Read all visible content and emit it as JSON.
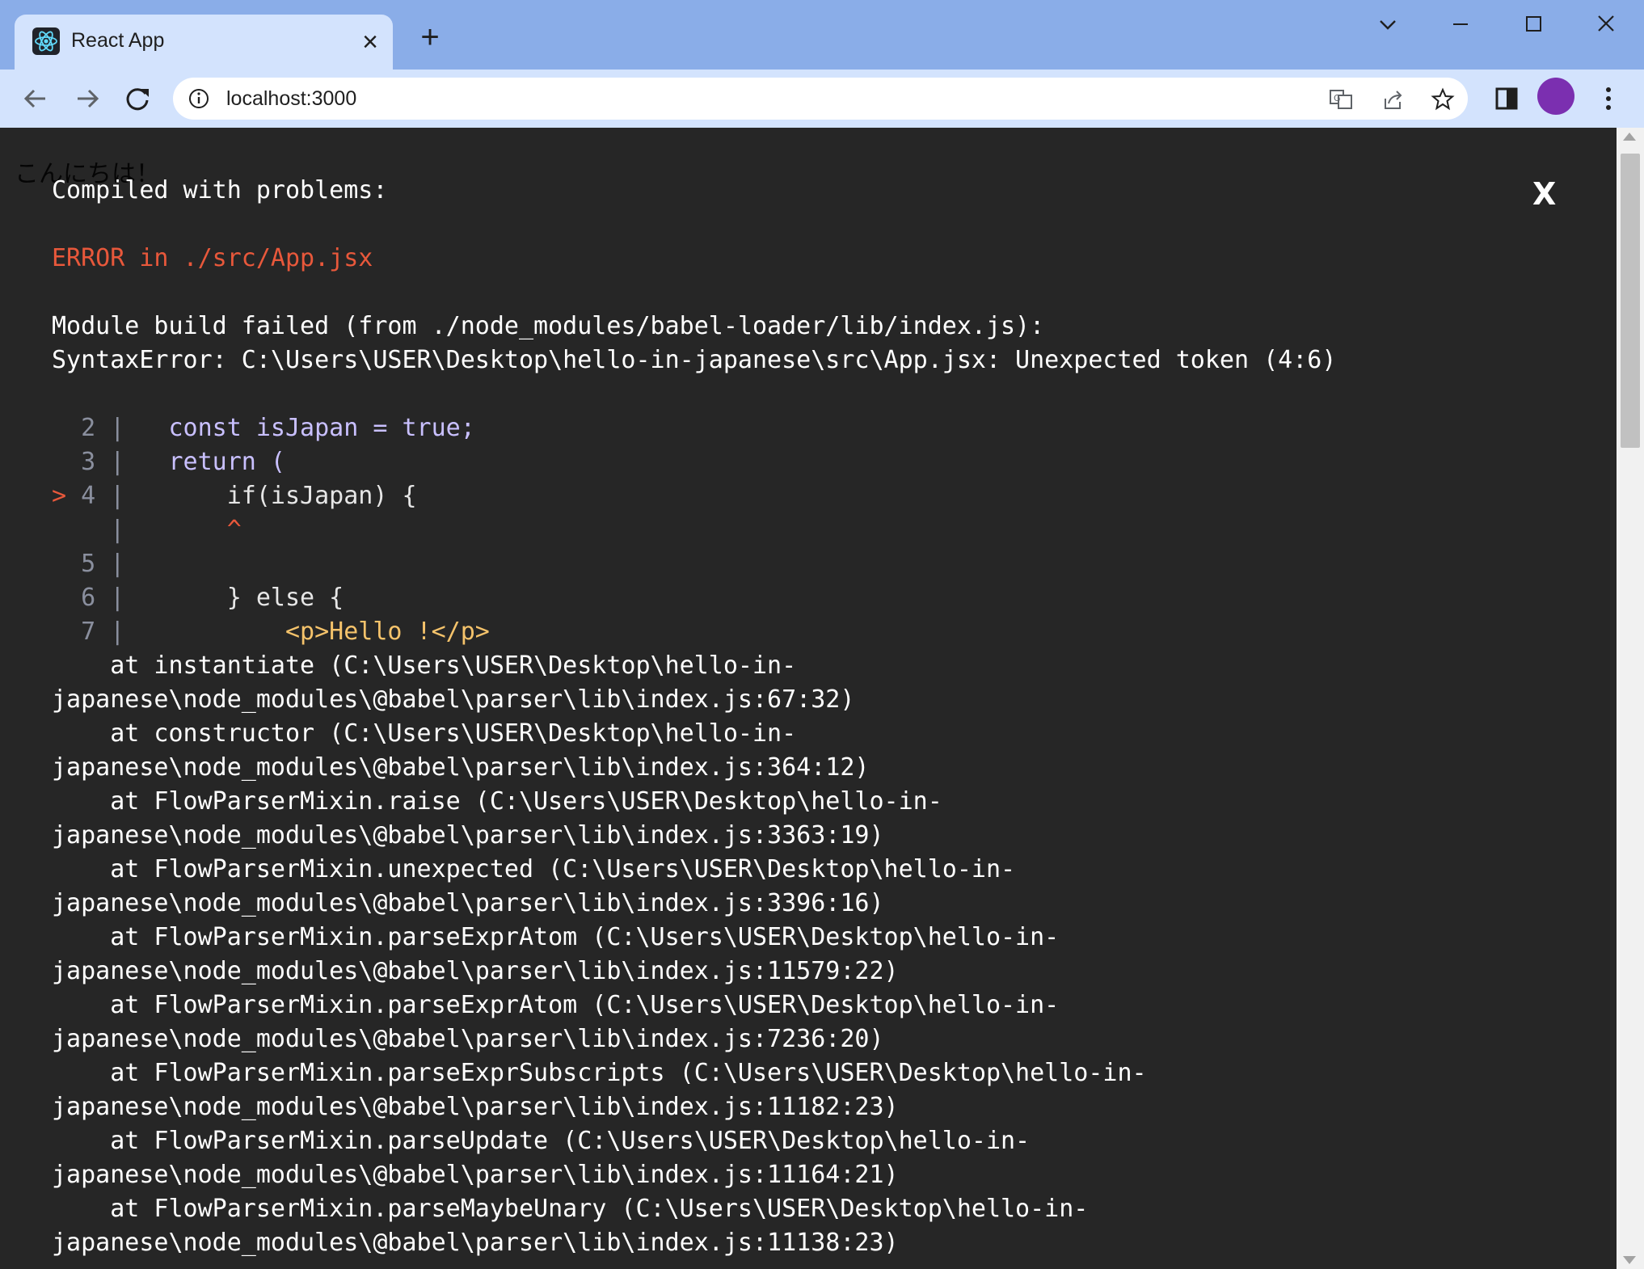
{
  "browser": {
    "tab_title": "React App",
    "tab_close": "×",
    "new_tab": "+",
    "url": "localhost:3000"
  },
  "page": {
    "background_text": "こんにちは！",
    "overlay": {
      "heading": "Compiled with problems:",
      "close": "X",
      "error_title": "ERROR in ./src/App.jsx",
      "message_lines": [
        "Module build failed (from ./node_modules/babel-loader/lib/index.js):",
        "SyntaxError: C:\\Users\\USER\\Desktop\\hello-in-japanese\\src\\App.jsx: Unexpected token (4:6)"
      ],
      "code_frame": [
        {
          "marker": " ",
          "num": "2",
          "code": "  const isJapan = true;"
        },
        {
          "marker": " ",
          "num": "3",
          "code": "  return ("
        },
        {
          "marker": ">",
          "num": "4",
          "code": "      if(isJapan) {"
        },
        {
          "marker": " ",
          "num": " ",
          "code": "      ^"
        },
        {
          "marker": " ",
          "num": "5",
          "code": ""
        },
        {
          "marker": " ",
          "num": "6",
          "code": "      } else {"
        },
        {
          "marker": " ",
          "num": "7",
          "code": "          <p>Hello !</p>"
        }
      ],
      "stack_lines": [
        "    at instantiate (C:\\Users\\USER\\Desktop\\hello-in-",
        "japanese\\node_modules\\@babel\\parser\\lib\\index.js:67:32)",
        "    at constructor (C:\\Users\\USER\\Desktop\\hello-in-",
        "japanese\\node_modules\\@babel\\parser\\lib\\index.js:364:12)",
        "    at FlowParserMixin.raise (C:\\Users\\USER\\Desktop\\hello-in-",
        "japanese\\node_modules\\@babel\\parser\\lib\\index.js:3363:19)",
        "    at FlowParserMixin.unexpected (C:\\Users\\USER\\Desktop\\hello-in-",
        "japanese\\node_modules\\@babel\\parser\\lib\\index.js:3396:16)",
        "    at FlowParserMixin.parseExprAtom (C:\\Users\\USER\\Desktop\\hello-in-",
        "japanese\\node_modules\\@babel\\parser\\lib\\index.js:11579:22)",
        "    at FlowParserMixin.parseExprAtom (C:\\Users\\USER\\Desktop\\hello-in-",
        "japanese\\node_modules\\@babel\\parser\\lib\\index.js:7236:20)",
        "    at FlowParserMixin.parseExprSubscripts (C:\\Users\\USER\\Desktop\\hello-in-",
        "japanese\\node_modules\\@babel\\parser\\lib\\index.js:11182:23)",
        "    at FlowParserMixin.parseUpdate (C:\\Users\\USER\\Desktop\\hello-in-",
        "japanese\\node_modules\\@babel\\parser\\lib\\index.js:11164:21)",
        "    at FlowParserMixin.parseMaybeUnary (C:\\Users\\USER\\Desktop\\hello-in-",
        "japanese\\node_modules\\@babel\\parser\\lib\\index.js:11138:23)"
      ]
    }
  },
  "colors": {
    "titlebar": "#8aade8",
    "toolbar": "#d3e3fd",
    "overlay_bg": "#262626",
    "error": "#e8583b",
    "avatar": "#7b2fb0"
  },
  "icons": [
    "react-logo-icon",
    "chevron-down-icon",
    "minimize-icon",
    "maximize-icon",
    "close-window-icon",
    "back-arrow-icon",
    "forward-arrow-icon",
    "reload-icon",
    "info-icon",
    "translate-icon",
    "share-icon",
    "bookmark-star-icon",
    "side-panel-icon",
    "kebab-menu-icon"
  ]
}
